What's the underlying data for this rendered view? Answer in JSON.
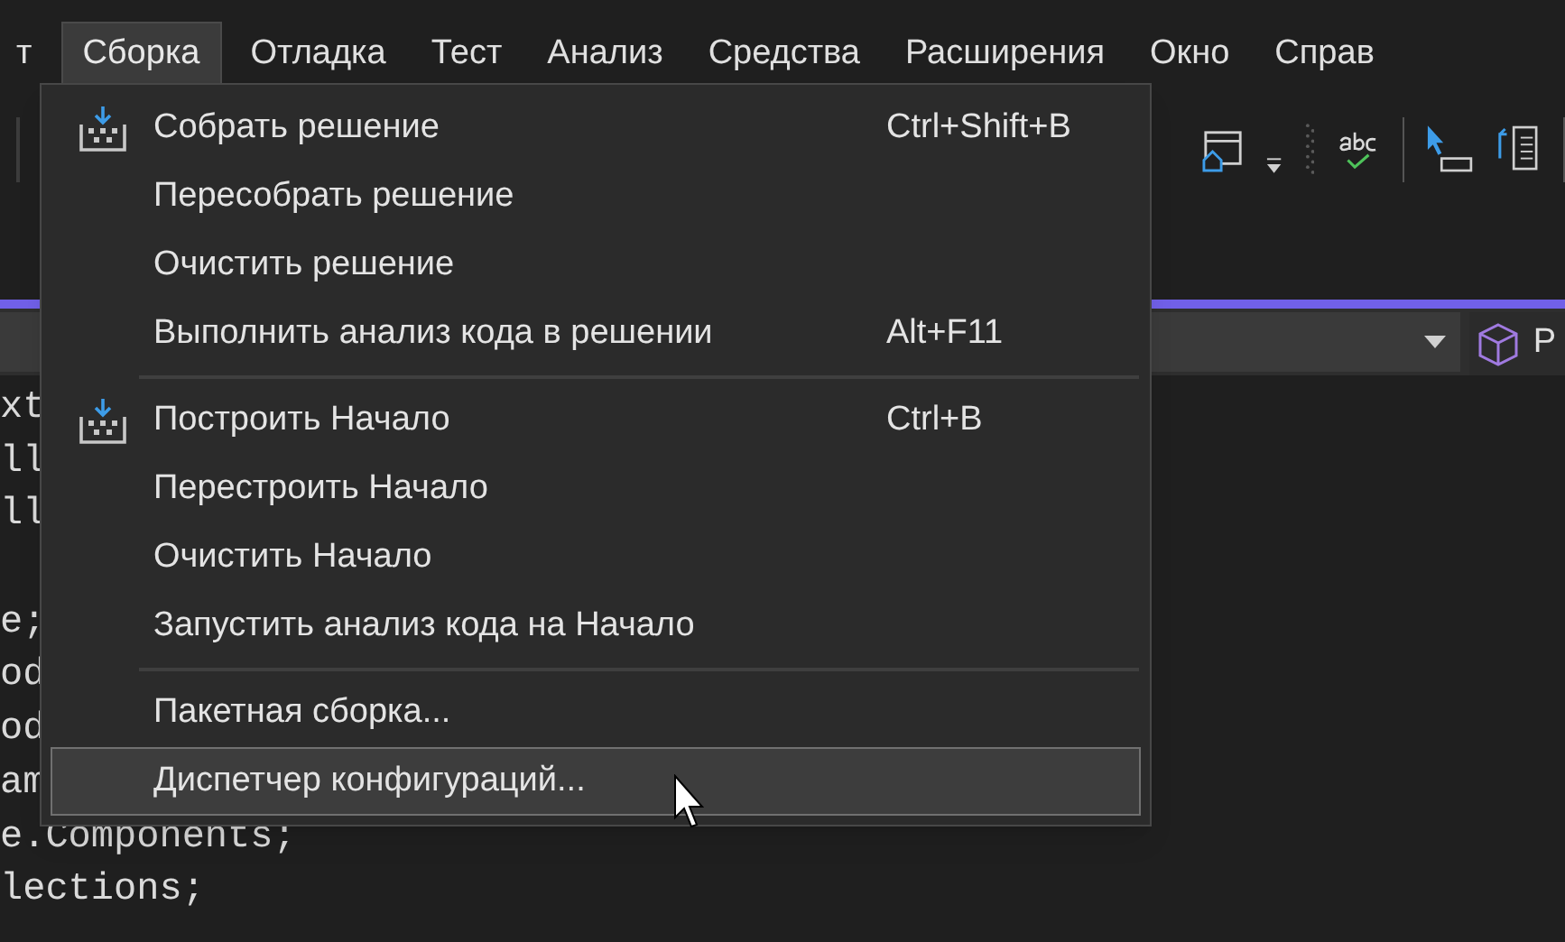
{
  "menu_bar": [
    {
      "label": "т",
      "selected": false
    },
    {
      "label": "Сборка",
      "selected": true
    },
    {
      "label": "Отладка",
      "selected": false
    },
    {
      "label": "Тест",
      "selected": false
    },
    {
      "label": "Анализ",
      "selected": false
    },
    {
      "label": "Средства",
      "selected": false
    },
    {
      "label": "Расширения",
      "selected": false
    },
    {
      "label": "Окно",
      "selected": false
    },
    {
      "label": "Справ",
      "selected": false
    }
  ],
  "project_selector": {
    "label": "P"
  },
  "code_lines": [
    {
      "kind": "code",
      "text": "xt"
    },
    {
      "kind": "code",
      "text": "ll"
    },
    {
      "kind": "code",
      "text": "ll"
    },
    {
      "kind": "blank"
    },
    {
      "kind": "code",
      "text": "e;"
    },
    {
      "kind": "code",
      "text": "od"
    },
    {
      "kind": "code",
      "text": "od"
    },
    {
      "kind": "code",
      "text": "am"
    },
    {
      "kind": "code",
      "text": "e.Components;"
    },
    {
      "kind": "code",
      "text": "lections;"
    }
  ],
  "build_menu": [
    {
      "kind": "build_item",
      "label": "Собрать решение",
      "shortcut": "Ctrl+Shift+B",
      "selected": false
    },
    {
      "kind": "item",
      "label": "Пересобрать решение",
      "selected": false
    },
    {
      "kind": "item",
      "label": "Очистить решение",
      "selected": false
    },
    {
      "kind": "item",
      "label": "Выполнить анализ кода в решении",
      "shortcut": "Alt+F11",
      "selected": false
    },
    {
      "kind": "separator"
    },
    {
      "kind": "build_item",
      "label": "Построить Начало",
      "shortcut": "Ctrl+B",
      "selected": false
    },
    {
      "kind": "item",
      "label": "Перестроить Начало",
      "selected": false
    },
    {
      "kind": "item",
      "label": "Очистить Начало",
      "selected": false
    },
    {
      "kind": "item",
      "label": "Запустить анализ кода на Начало",
      "selected": false
    },
    {
      "kind": "separator"
    },
    {
      "kind": "item",
      "label": "Пакетная сборка...",
      "selected": false
    },
    {
      "kind": "item",
      "label": "Диспетчер конфигураций...",
      "selected": true
    }
  ]
}
